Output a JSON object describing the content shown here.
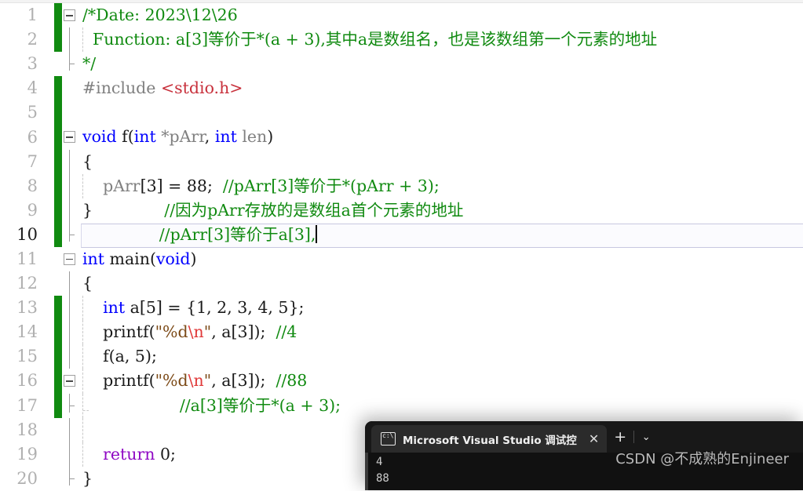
{
  "editor": {
    "name": "visual-studio-code-editor",
    "colors": {
      "comment": "#108a10",
      "keyword": "#0000ff",
      "identifier": "#808080",
      "string": "#7c4a17",
      "escape": "#e03a3a",
      "include": "#c8313c",
      "control": "#8f08c4",
      "changebar": "#108a10",
      "current_line_border": "#c8c8e0",
      "line_number": "#b0b0b0"
    },
    "lines": [
      {
        "number": "1",
        "changed": true,
        "text": "/*Date: 2023\\12\\26"
      },
      {
        "number": "2",
        "changed": true,
        "text": "  Function: a[3]等价于*(a + 3),其中a是数组名，也是该数组第一个元素的地址"
      },
      {
        "number": "3",
        "changed": false,
        "text": "*/"
      },
      {
        "number": "4",
        "changed": true,
        "text": "#include <stdio.h>"
      },
      {
        "number": "5",
        "changed": true,
        "text": ""
      },
      {
        "number": "6",
        "changed": true,
        "text": "void f(int *pArr, int len)"
      },
      {
        "number": "7",
        "changed": true,
        "text": "{"
      },
      {
        "number": "8",
        "changed": true,
        "text": "    pArr[3] = 88;  //pArr[3]等价于*(pArr + 3);"
      },
      {
        "number": "9",
        "changed": true,
        "text": "}              //因为pArr存放的是数组a首个元素的地址"
      },
      {
        "number": "10",
        "changed": true,
        "text": "               //pArr[3]等价于a[3],",
        "current": true
      },
      {
        "number": "11",
        "changed": false,
        "text": "int main(void)"
      },
      {
        "number": "12",
        "changed": false,
        "text": "{"
      },
      {
        "number": "13",
        "changed": true,
        "text": "    int a[5] = {1, 2, 3, 4, 5};"
      },
      {
        "number": "14",
        "changed": true,
        "text": "    printf(\"%d\\n\", a[3]);  //4"
      },
      {
        "number": "15",
        "changed": true,
        "text": "    f(a, 5);"
      },
      {
        "number": "16",
        "changed": true,
        "text": "    printf(\"%d\\n\", a[3]);  //88"
      },
      {
        "number": "17",
        "changed": true,
        "text": "                   //a[3]等价于*(a + 3);"
      },
      {
        "number": "18",
        "changed": false,
        "text": ""
      },
      {
        "number": "19",
        "changed": false,
        "text": "    return 0;"
      },
      {
        "number": "20",
        "changed": false,
        "text": "}"
      }
    ],
    "tokens": {
      "date_comment": "/*Date: 2023\\12\\26",
      "function_comment": "  Function: a[3]等价于*(a + 3),其中a是数组名，也是该数组第一个元素的地址",
      "comment_close": "*/",
      "preproc": "#include ",
      "include_header": "<stdio.h>",
      "kw_void": "void",
      "fn_f": " f",
      "paren_open": "(",
      "kw_int": "int",
      "ptr_pArr": " *pArr",
      "comma": ", ",
      "kw_int2": "int",
      "ident_len": " len",
      "paren_close": ")",
      "brace_open": "{",
      "brace_close": "}",
      "parr_assign_ident": "pArr",
      "parr_assign_index": "[3] = ",
      "parr_assign_value": "88",
      "semicolon": ";",
      "comment_line8": "//pArr[3]等价于*(pArr + 3);",
      "comment_line9": "//因为pArr存放的是数组a首个元素的地址",
      "comment_line10": "//pArr[3]等价于a[3],",
      "kw_int_main": "int",
      "fn_main": " main",
      "kw_void_param": "void",
      "decl_int": "int",
      "decl_a": " a[5] = {1, 2, 3, 4, 5};",
      "printf_name": "printf",
      "printf_open": "(",
      "printf_str_open": "\"%d",
      "printf_escape": "\\n",
      "printf_str_close": "\"",
      "printf_args": ", a[3]);",
      "comment_4": "//4",
      "comment_88": "//88",
      "comment_line17": "//a[3]等价于*(a + 3);",
      "call_f": "f(a, 5);",
      "kw_return": "return",
      "return_value": " 0;"
    }
  },
  "terminal": {
    "tab_title": "Microsoft Visual Studio 调试控",
    "tab_icon": "console-icon",
    "close_label": "✕",
    "new_tab_label": "+",
    "dropdown_label": "⌄",
    "output_lines": [
      "4",
      "88"
    ]
  },
  "watermark": {
    "text": "CSDN @不成熟的Enjineer"
  }
}
